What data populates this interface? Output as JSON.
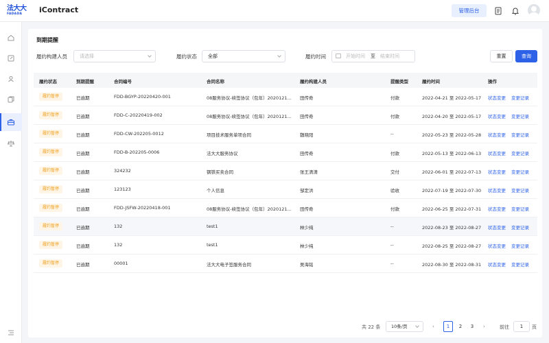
{
  "header": {
    "logo_cn": "法大大",
    "logo_en": "FADADA",
    "app_title": "iContract",
    "admin_label": "管理后台"
  },
  "sidebar": {
    "icons": [
      "home-icon",
      "edit-icon",
      "users-icon",
      "copy-icon",
      "briefcase-icon",
      "scale-icon"
    ],
    "active_index": 4,
    "footer_icon": "menu-toggle-icon"
  },
  "page": {
    "title": "到期提醒"
  },
  "filters": {
    "creator_label": "履约构建人员",
    "creator_placeholder": "请选择",
    "status_label": "履约状态",
    "status_value": "全部",
    "time_label": "履约时间",
    "start_placeholder": "开始时间",
    "range_sep": "至",
    "end_placeholder": "结束时间",
    "reset_label": "重置",
    "query_label": "查询"
  },
  "table": {
    "headers": [
      "履约状态",
      "到期提醒",
      "合同编号",
      "合同名称",
      "履约构建人员",
      "提醒类型",
      "履约时间",
      "操作"
    ],
    "action_status": "状态变更",
    "action_log": "变更记录",
    "rows": [
      {
        "status": "履约暂停",
        "reminder": "已逾期",
        "contract_no": "FDD-BGYP-20220420-001",
        "contract_name": "08服务协议-续签协议（包年）2020121...",
        "creator": "田传奇",
        "type": "付款",
        "time": "2022-04-21 至 2022-05-17"
      },
      {
        "status": "履约暂停",
        "reminder": "已逾期",
        "contract_no": "FDD-C-20220419-002",
        "contract_name": "08服务协议-续签协议（包年）2020121...",
        "creator": "田传奇",
        "type": "付款",
        "time": "2022-04-20 至 2022-05-17"
      },
      {
        "status": "履约暂停",
        "reminder": "已逾期",
        "contract_no": "FDD-CW-202205-0012",
        "contract_name": "项目技术服务单项合同",
        "creator": "魏晓阳",
        "type": "--",
        "time": "2022-05-23 至 2022-05-28"
      },
      {
        "status": "履约暂停",
        "reminder": "已逾期",
        "contract_no": "FDD-B-202205-0006",
        "contract_name": "法大大服务协议",
        "creator": "田传奇",
        "type": "付款",
        "time": "2022-05-13 至 2022-06-13"
      },
      {
        "status": "履约暂停",
        "reminder": "已逾期",
        "contract_no": "324232",
        "contract_name": "钢铁买卖合同",
        "creator": "张王清清",
        "type": "交付",
        "time": "2022-06-01 至 2022-07-13"
      },
      {
        "status": "履约暂停",
        "reminder": "已逾期",
        "contract_no": "123123",
        "contract_name": "个人信息",
        "creator": "邹定洪",
        "type": "验收",
        "time": "2022-07-19 至 2022-07-30"
      },
      {
        "status": "履约暂停",
        "reminder": "已逾期",
        "contract_no": "FDD-JSFW-20220418-001",
        "contract_name": "08服务协议-续签协议（包年）2020121...",
        "creator": "田传奇",
        "type": "付款",
        "time": "2022-06-25 至 2022-07-31"
      },
      {
        "status": "履约暂停",
        "reminder": "已逾期",
        "contract_no": "132",
        "contract_name": "test1",
        "creator": "林少纯",
        "type": "--",
        "time": "2022-08-23 至 2022-08-27"
      },
      {
        "status": "履约暂停",
        "reminder": "已逾期",
        "contract_no": "132",
        "contract_name": "test1",
        "creator": "林少纯",
        "type": "--",
        "time": "2022-08-25 至 2022-08-27"
      },
      {
        "status": "履约暂停",
        "reminder": "已逾期",
        "contract_no": "00001",
        "contract_name": "法大大电子签服务合同",
        "creator": "吴海铭",
        "type": "--",
        "time": "2022-08-30 至 2022-08-31"
      }
    ]
  },
  "pagination": {
    "total": "共 22 条",
    "page_size": "10条/页",
    "pages": [
      "1",
      "2",
      "3"
    ],
    "current": "1",
    "goto_label": "前往",
    "goto_value": "1",
    "page_suffix": "页"
  },
  "colors": {
    "primary": "#2d62e8",
    "badge_text": "#f0a020",
    "badge_bg": "#fff5e6"
  }
}
